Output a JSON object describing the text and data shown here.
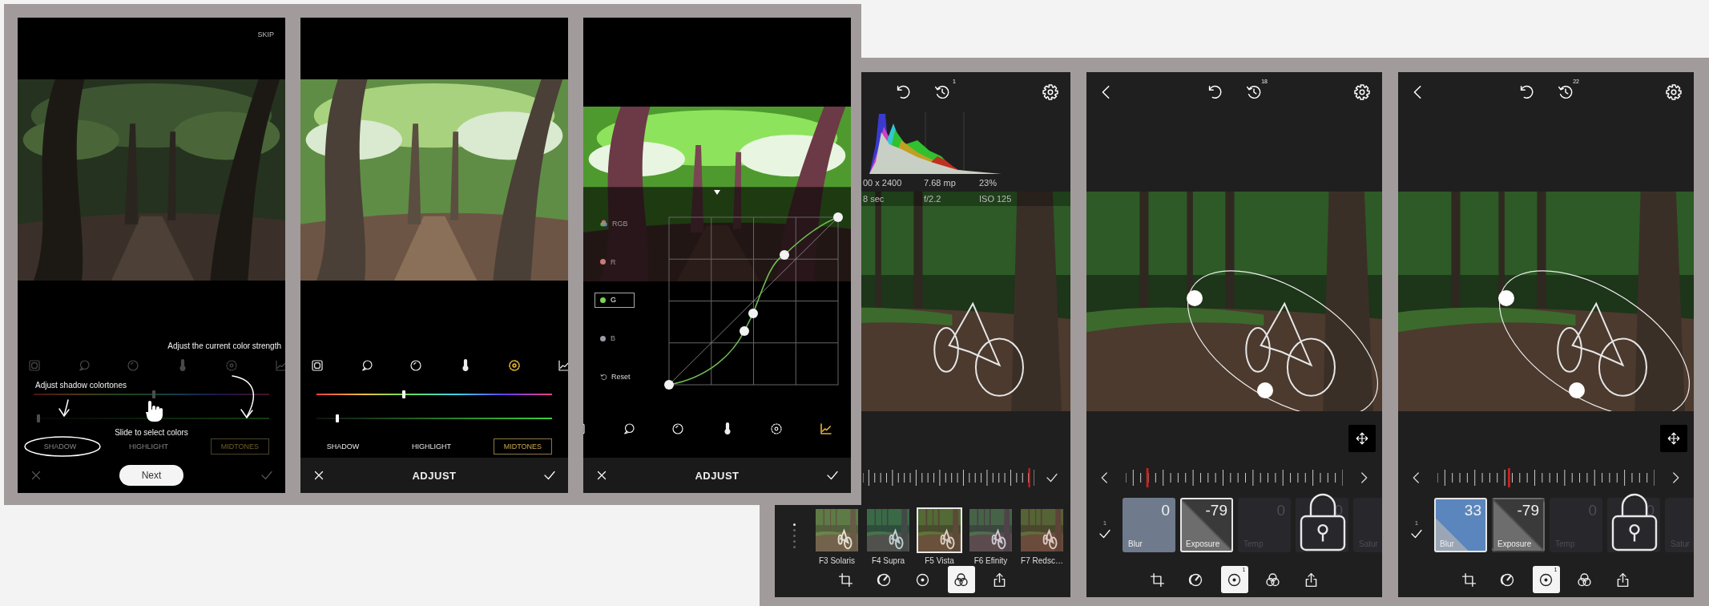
{
  "screens": [
    {
      "kind": "tutorial",
      "skip": "SKIP",
      "photo": {
        "kind": "picture"
      },
      "strength_hint": "Adjust the current color strength",
      "shadow_hint": "Adjust shadow colortones",
      "slide_hint": "Slide to select colors",
      "tools": [
        {
          "selected": false
        },
        {
          "selected": false
        },
        {
          "selected": false
        },
        {
          "selected": false
        },
        {
          "selected": false
        },
        {
          "selected": false
        }
      ],
      "hue": {
        "level": 0.51
      },
      "strength": {
        "level": 0.02
      },
      "tones": [
        {
          "label": "SHADOW",
          "selected": false
        },
        {
          "label": "HIGHLIGHT",
          "selected": false
        },
        {
          "label": "MIDTONES",
          "selected": true
        }
      ],
      "next": "Next"
    },
    {
      "kind": "adjust",
      "photo": {
        "kind": "picture"
      },
      "tools": [
        {
          "selected": false
        },
        {
          "selected": false
        },
        {
          "selected": false
        },
        {
          "selected": false
        },
        {
          "selected": true
        },
        {
          "selected": false
        }
      ],
      "hue": {
        "level": 0.37
      },
      "strength": {
        "level": 0.09
      },
      "tones": [
        {
          "label": "SHADOW",
          "selected": false
        },
        {
          "label": "HIGHLIGHT",
          "selected": false
        },
        {
          "label": "MIDTONES",
          "selected": true
        }
      ],
      "title": "ADJUST"
    },
    {
      "kind": "curves",
      "photo": {
        "kind": "picture"
      },
      "channels": [
        {
          "label": "RGB",
          "kind": "mixed",
          "selected": false
        },
        {
          "label": "R",
          "kind": "single",
          "color": "#c97a7a",
          "selected": false
        },
        {
          "label": "G",
          "kind": "single",
          "color": "#7bd35a",
          "selected": true
        },
        {
          "label": "B",
          "kind": "single",
          "color": "#9b9bab",
          "selected": false
        }
      ],
      "reset": "Reset",
      "tools": [
        {
          "selected": false
        },
        {
          "selected": false
        },
        {
          "selected": false
        },
        {
          "selected": false
        },
        {
          "selected": false
        },
        {
          "selected": true
        }
      ],
      "title": "ADJUST"
    },
    {
      "kind": "filters",
      "history_badge": "1",
      "histogram_info": [
        "00 x 2400",
        "7.68 mp",
        "23%"
      ],
      "exif": [
        "8 sec",
        "f/2.2",
        "ISO 125"
      ],
      "photo": {
        "kind": "picture"
      },
      "ruler": {
        "level": 0.97
      },
      "pages": [
        {
          "selected": true
        },
        {
          "selected": false
        },
        {
          "selected": false
        },
        {
          "selected": false
        },
        {
          "selected": false
        }
      ],
      "filters": [
        {
          "label": "F3 Solaris",
          "selected": false
        },
        {
          "label": "F4 Supra",
          "selected": false
        },
        {
          "label": "F5 Vista",
          "selected": true
        },
        {
          "label": "F6 Efinity",
          "selected": false
        },
        {
          "label": "F7 Redsc…",
          "selected": false
        }
      ],
      "toolbar": [
        {
          "selected": false
        },
        {
          "selected": false
        },
        {
          "selected": false
        },
        {
          "selected": true
        },
        {
          "selected": false
        }
      ]
    },
    {
      "kind": "mask",
      "history_badge": "18",
      "photo": {
        "kind": "picture"
      },
      "ruler": {
        "level": 0.1
      },
      "applied_count": "1",
      "adjustments": [
        {
          "label": "Blur",
          "value": "0",
          "selected": false,
          "disabled": false,
          "locked": false
        },
        {
          "label": "Exposure",
          "value": "-79",
          "selected": true,
          "disabled": false,
          "locked": false
        },
        {
          "label": "Temp",
          "value": "0",
          "selected": false,
          "disabled": true,
          "locked": false
        },
        {
          "value": "0",
          "selected": false,
          "disabled": true,
          "locked": true
        },
        {
          "label": "Satur",
          "selected": false,
          "disabled": true,
          "locked": false
        }
      ],
      "toolbar": [
        {
          "selected": false
        },
        {
          "selected": false
        },
        {
          "selected": true,
          "badge": "1"
        },
        {
          "selected": false
        },
        {
          "selected": false
        }
      ]
    },
    {
      "kind": "mask",
      "history_badge": "22",
      "photo": {
        "kind": "picture"
      },
      "ruler": {
        "level": 0.33
      },
      "applied_count": "1",
      "adjustments": [
        {
          "label": "Blur",
          "value": "33",
          "selected": true,
          "disabled": false,
          "locked": false
        },
        {
          "label": "Exposure",
          "value": "-79",
          "selected": false,
          "disabled": false,
          "locked": false
        },
        {
          "label": "Temp",
          "value": "0",
          "selected": false,
          "disabled": true,
          "locked": false
        },
        {
          "value": "0",
          "selected": false,
          "disabled": true,
          "locked": true
        },
        {
          "label": "Satur",
          "selected": false,
          "disabled": true,
          "locked": false
        }
      ],
      "toolbar": [
        {
          "selected": false
        },
        {
          "selected": false
        },
        {
          "selected": true,
          "badge": "1"
        },
        {
          "selected": false
        },
        {
          "selected": false
        }
      ]
    }
  ]
}
